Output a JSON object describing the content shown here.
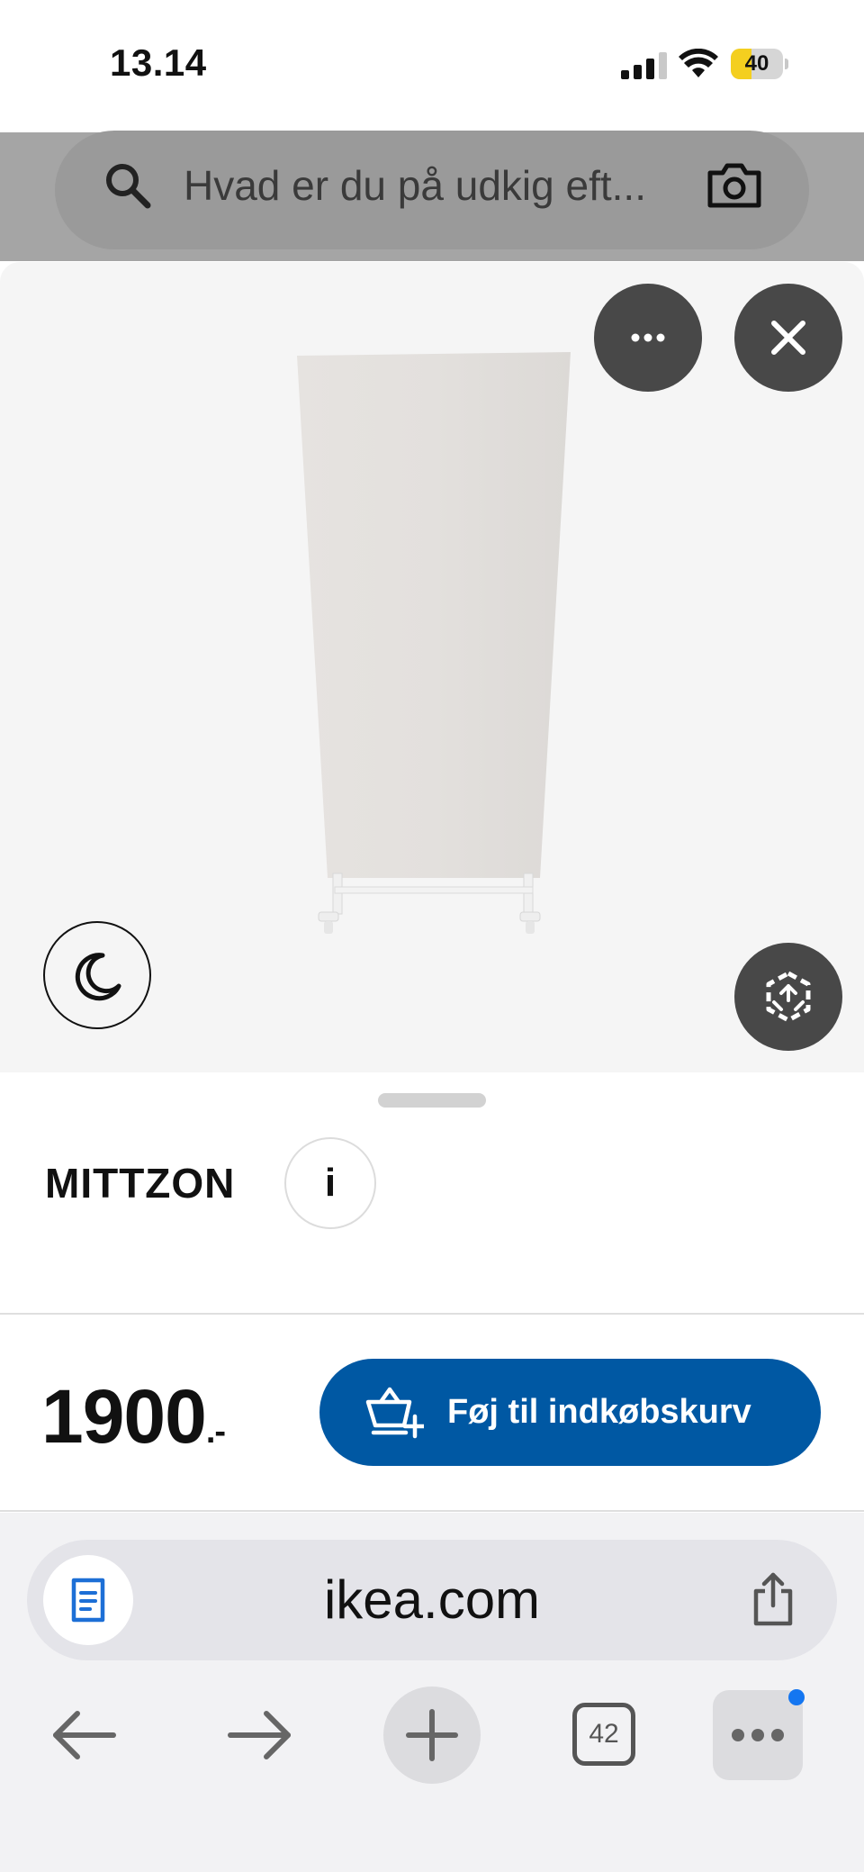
{
  "status_bar": {
    "time": "13.14",
    "battery_level": "40",
    "battery_fraction": 0.4
  },
  "search": {
    "placeholder": "Hvad er du på udkig eft..."
  },
  "product": {
    "name": "MITTZON",
    "info_label": "i",
    "price": "1900",
    "price_suffix": ".-",
    "add_to_cart_label": "Føj til indkøbskurv"
  },
  "browser": {
    "url": "ikea.com",
    "tab_count": "42"
  },
  "icons": {
    "search": "search-icon",
    "camera": "camera-icon",
    "more": "more-dots-icon",
    "close": "close-icon",
    "night_mode": "moon-icon",
    "ar_view": "ar-cube-icon",
    "cart": "cart-add-icon",
    "reader": "reader-icon",
    "share": "share-icon",
    "back": "arrow-left-icon",
    "forward": "arrow-right-icon",
    "new_tab": "plus-icon",
    "tabs": "tabs-icon",
    "menu": "ellipsis-icon"
  },
  "colors": {
    "primary_button": "#0058a3",
    "overlay_buttons": "#484848",
    "notification_dot": "#1476f1",
    "battery": "#f4cf1f"
  }
}
